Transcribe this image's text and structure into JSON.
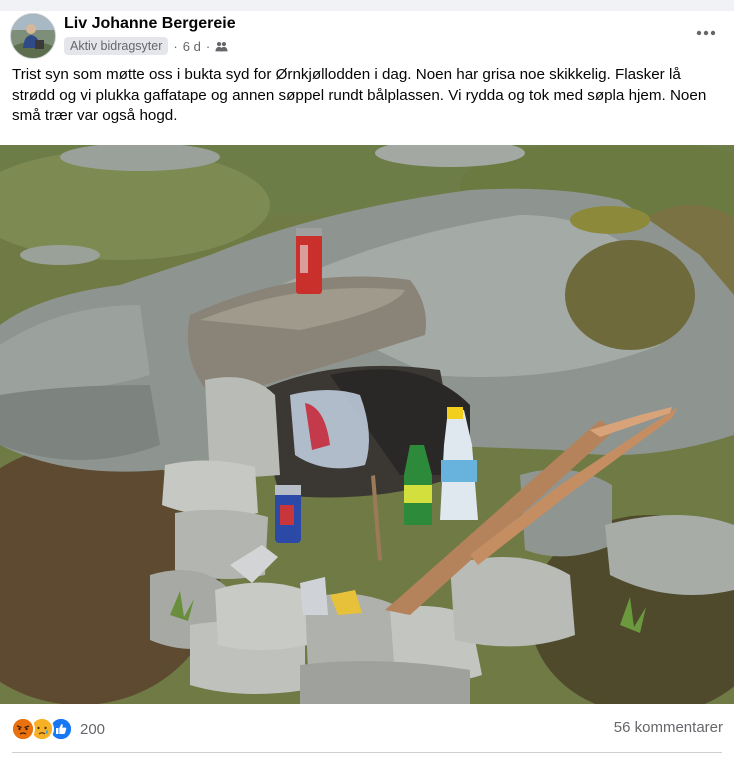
{
  "post": {
    "author": "Liv Johanne Bergereie",
    "badge": "Aktiv bidragsyter",
    "time": "6 d",
    "separator": "·",
    "text": "Trist syn som møtte oss i bukta syd for Ørnkjøllodden i dag. Noen har grisa noe skikkelig. Flasker lå strødd og vi plukka gaffatape og annen søppel rundt bålplassen.  Vi rydda og tok med søpla hjem. Noen små trær var også hogd."
  },
  "icons": {
    "more": "more-horizontal-icon",
    "audience": "friends-audience-icon",
    "reactions": [
      "angry-reaction-icon",
      "sad-reaction-icon",
      "like-reaction-icon"
    ]
  },
  "footer": {
    "reaction_count": "200",
    "comments": "56 kommentarer"
  },
  "colors": {
    "text_secondary": "#65676b",
    "like_blue": "#1877f2",
    "angry_orange": "#e9710f",
    "sad_yellow": "#f7b125"
  }
}
